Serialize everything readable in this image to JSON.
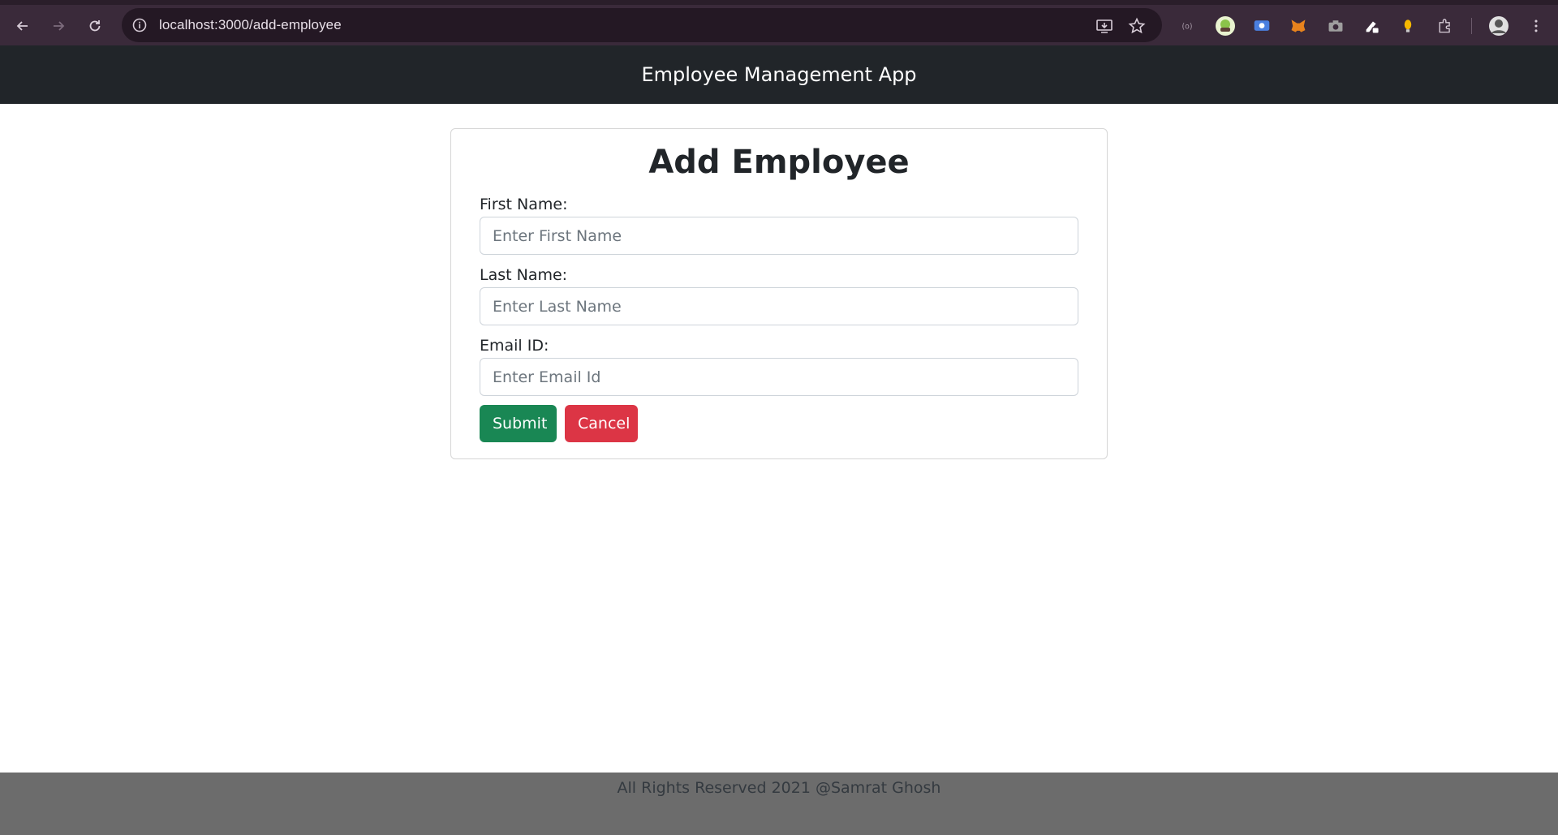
{
  "browser": {
    "url": "localhost:3000/add-employee"
  },
  "app": {
    "brand": "Employee Management App"
  },
  "form": {
    "title": "Add Employee",
    "first_name_label": "First Name:",
    "first_name_placeholder": "Enter First Name",
    "first_name_value": "",
    "last_name_label": "Last Name:",
    "last_name_placeholder": "Enter Last Name",
    "last_name_value": "",
    "email_label": "Email ID:",
    "email_placeholder": "Enter Email Id",
    "email_value": "",
    "submit_label": "Submit",
    "cancel_label": "Cancel"
  },
  "footer": {
    "text": "All Rights Reserved 2021 @Samrat Ghosh"
  },
  "colors": {
    "header_bg": "#212529",
    "submit_bg": "#198754",
    "cancel_bg": "#dc3545",
    "footer_bg": "#6c6c6c"
  }
}
